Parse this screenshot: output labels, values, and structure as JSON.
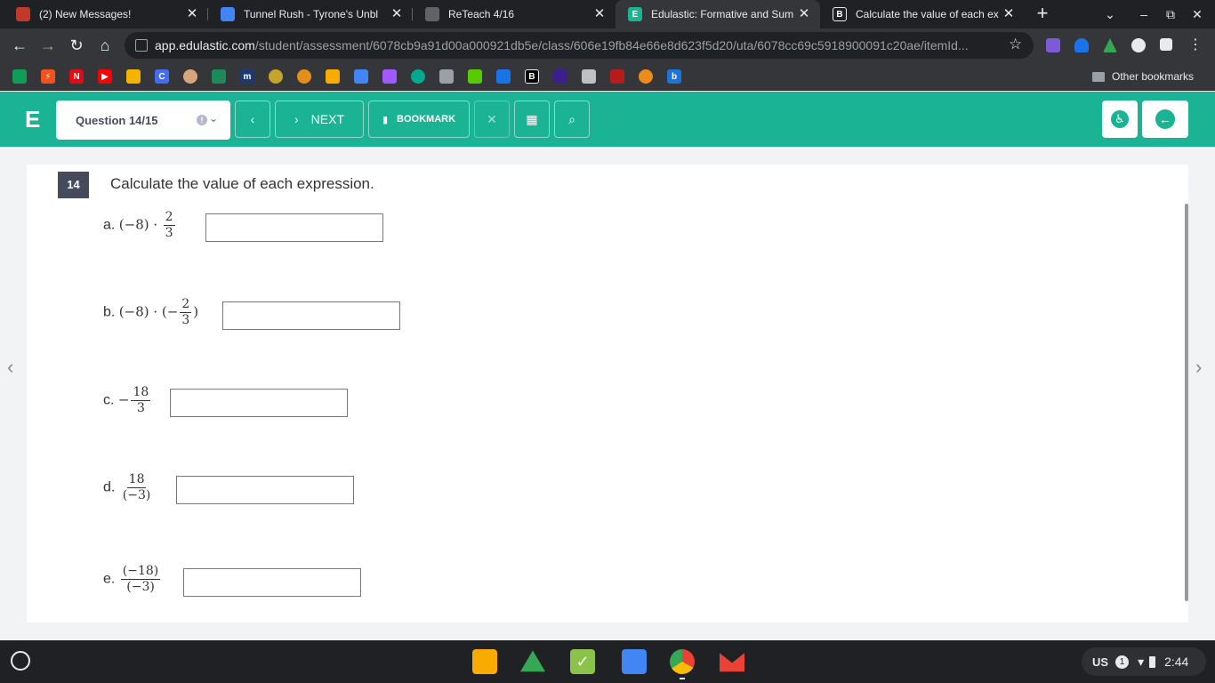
{
  "tabs": [
    {
      "title": "(2) New Messages!",
      "fav_color": "#c0392b",
      "active": false
    },
    {
      "title": "Tunnel Rush - Tyrone's Unbl",
      "fav_color": "#4285f4",
      "active": false
    },
    {
      "title": "ReTeach 4/16",
      "fav_color": "#5f6368",
      "active": false
    },
    {
      "title": "Edulastic: Formative and Sum",
      "fav_color": "#1ab394",
      "active": true
    },
    {
      "title": "Calculate the value of each ex",
      "fav_color": "#202124",
      "active": false
    }
  ],
  "address": {
    "host": "app.edulastic.com",
    "path": "/student/assessment/6078cb9a91d00a000921db5e/class/606e19fb84e66e8d623f5d20/uta/6078cc69c5918900091c20ae/itemId..."
  },
  "bookmarks": {
    "icons": [
      "classroom",
      "bolt",
      "netflix",
      "youtube",
      "sheets",
      "clever",
      "face",
      "pen",
      "math",
      "pear",
      "spiral",
      "chart",
      "docs",
      "figma",
      "vpn",
      "calc",
      "duo",
      "blocks",
      "brainly",
      "purple",
      "feather",
      "spider",
      "orange",
      "bing"
    ],
    "other_label": "Other bookmarks"
  },
  "header": {
    "logo": "E",
    "question_select": "Question 14/15",
    "warn_glyph": "!",
    "next_label": "NEXT",
    "bookmark_label": "BOOKMARK"
  },
  "question": {
    "number": "14",
    "prompt": "Calculate the value of each expression.",
    "items": [
      {
        "label": "a.",
        "pre": "(−8) ·",
        "num": "2",
        "den": "3",
        "post": ""
      },
      {
        "label": "b.",
        "pre": "(−8) · (−",
        "num": "2",
        "den": "3",
        "post": ")"
      },
      {
        "label": "c.",
        "pre": "−",
        "num": "18",
        "den": "3",
        "post": ""
      },
      {
        "label": "d.",
        "pre": "",
        "num": "18",
        "den": "(−3)",
        "post": ""
      },
      {
        "label": "e.",
        "pre": "",
        "num": "(−18)",
        "den": "(−3)",
        "post": ""
      }
    ]
  },
  "tray": {
    "locale": "US",
    "notif": "1",
    "time": "2:44"
  }
}
